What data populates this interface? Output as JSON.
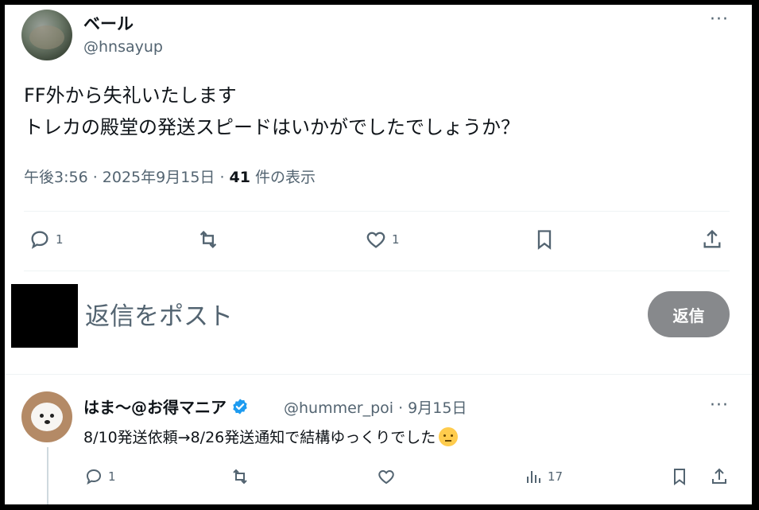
{
  "post": {
    "author_name": "ベール",
    "author_handle": "@hnsayup",
    "text": "FF外から失礼いたします\nトレカの殿堂の発送スピードはいかがでしたでしょうか？",
    "time": "午後3:56 · 2025年9月15日 · ",
    "views_count": "41",
    "views_suffix": " 件の表示",
    "more": "···",
    "replies": "1",
    "likes": "1"
  },
  "composer": {
    "placeholder": "返信をポスト",
    "button_label": "返信"
  },
  "reply": {
    "author_name": "はま～@お得マニア",
    "author_handle": "@hummer_poi · 9月15日",
    "text": "8/10発送依頼→8/26発送通知で結構ゆっくりでした",
    "more": "···",
    "replies": "1",
    "views": "17"
  },
  "colors": {
    "text": "#0f1419",
    "muted": "#536471",
    "verified": "#1d9bf0",
    "reply_button": "#87898c"
  }
}
